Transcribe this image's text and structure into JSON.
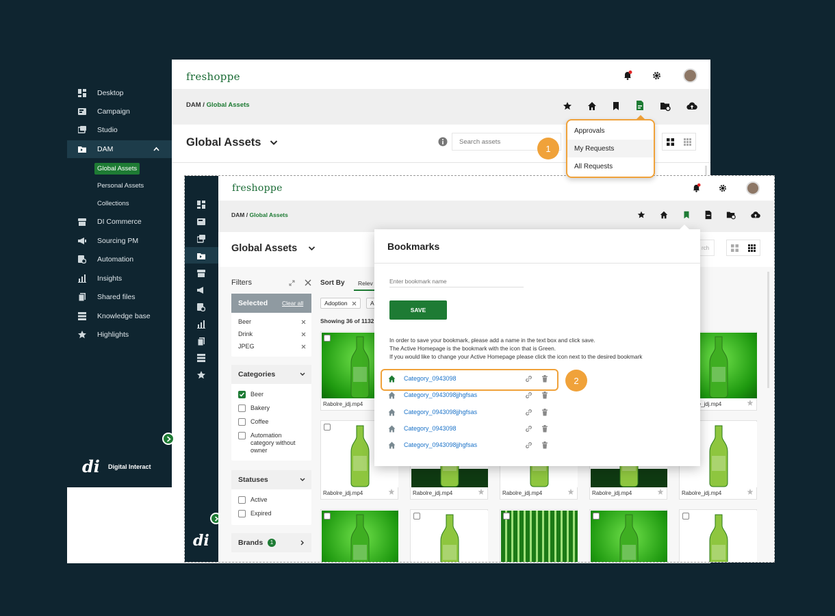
{
  "back_window": {
    "brand": "freshoppe",
    "sidebar": {
      "items": [
        {
          "label": "Desktop",
          "icon": "desktop-icon"
        },
        {
          "label": "Campaign",
          "icon": "campaign-icon"
        },
        {
          "label": "Studio",
          "icon": "studio-icon"
        },
        {
          "label": "DAM",
          "icon": "dam-icon"
        },
        {
          "label": "DI Commerce",
          "icon": "commerce-icon"
        },
        {
          "label": "Sourcing PM",
          "icon": "sourcing-icon"
        },
        {
          "label": "Automation",
          "icon": "automation-icon"
        },
        {
          "label": "Insights",
          "icon": "insights-icon"
        },
        {
          "label": "Shared files",
          "icon": "shared-files-icon"
        },
        {
          "label": "Knowledge base",
          "icon": "knowledge-base-icon"
        },
        {
          "label": "Highlights",
          "icon": "highlights-icon"
        }
      ],
      "dam_subitems": [
        "Global Assets",
        "Personal Assets",
        "Collections"
      ],
      "footer_logo": "di",
      "footer_text": "Digital Interact"
    },
    "breadcrumb": {
      "root": "DAM",
      "separator": "/",
      "current": "Global Assets"
    },
    "page_title": "Global Assets",
    "search_placeholder": "Search assets",
    "dropdown": [
      "Approvals",
      "My Requests",
      "All Requests"
    ],
    "callout": "1"
  },
  "front_window": {
    "brand": "freshoppe",
    "breadcrumb": {
      "root": "DAM",
      "separator": "/",
      "current": "Global Assets"
    },
    "page_title": "Global Assets",
    "search_fragment": "rch",
    "filters": {
      "title": "Filters",
      "selected_label": "Selected",
      "clear_all": "Clear all",
      "selected": [
        "Beer",
        "Drink",
        "JPEG"
      ],
      "categories_title": "Categories",
      "categories": [
        {
          "label": "Beer",
          "checked": true
        },
        {
          "label": "Bakery",
          "checked": false
        },
        {
          "label": "Coffee",
          "checked": false
        },
        {
          "label": "Automation category without owner",
          "checked": false
        }
      ],
      "statuses_title": "Statuses",
      "statuses": [
        "Active",
        "Expired"
      ],
      "brands_title": "Brands",
      "brands_count": "1"
    },
    "sort_label": "Sort By",
    "sort_value": "Relev",
    "chips": [
      "Adoption",
      "A"
    ],
    "showing": "Showing 36 of 1132",
    "asset_caption": "Rabolre_jdj.mp4",
    "footer_logo": "di"
  },
  "bookmarks": {
    "title": "Bookmarks",
    "input_placeholder": "Enter bookmark name",
    "save_label": "SAVE",
    "help_lines": [
      "In order to save your bookmark, please add a name in the text box and click save.",
      "The Active Homepage is the bookmark with the icon that is Green.",
      "If you would like to change your Active Homepage please click the icon next to the desired bookmark"
    ],
    "items": [
      {
        "name": "Category_0943098",
        "active": true
      },
      {
        "name": "Category_0943098jjhgfsas",
        "active": false
      },
      {
        "name": "Category_0943098jjhgfsas",
        "active": false
      },
      {
        "name": "Category_0943098",
        "active": false
      },
      {
        "name": "Category_0943098jjhgfsas",
        "active": false
      }
    ],
    "callout": "2"
  },
  "colors": {
    "brand_green": "#1e7b34",
    "navy": "#0f2530",
    "callout_orange": "#f0a23a",
    "link_blue": "#1a72c8"
  }
}
